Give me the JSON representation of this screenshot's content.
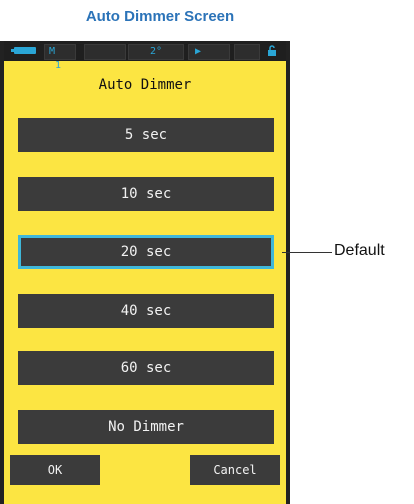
{
  "caption": "Auto Dimmer Screen",
  "status_bar": {
    "mode": "M",
    "memory": "1",
    "angle": "2°",
    "icons": [
      "battery-icon",
      "lock-icon"
    ]
  },
  "title": "Auto Dimmer",
  "options": [
    "5 sec",
    "10 sec",
    "20 sec",
    "40 sec",
    "60 sec",
    "No Dimmer"
  ],
  "selected_option": "20 sec",
  "buttons": {
    "ok": "OK",
    "cancel": "Cancel"
  },
  "callout": "Default",
  "colors": {
    "caption": "#2b73b8",
    "screen_bg": "#fce542",
    "button_bg": "#3b3b3b",
    "selection_border": "#3fb7d9"
  }
}
